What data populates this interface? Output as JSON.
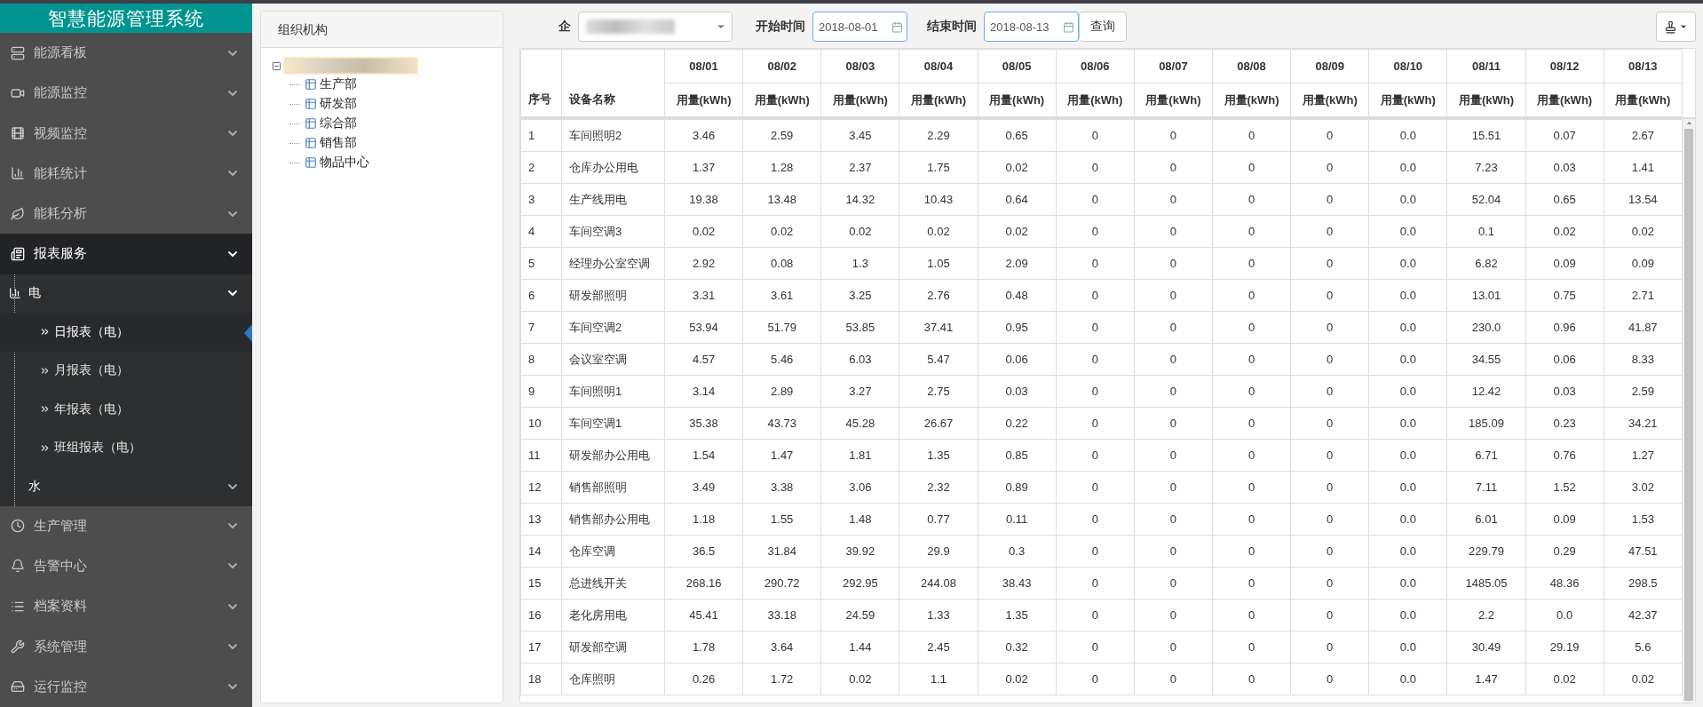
{
  "sidebar": {
    "title": "智慧能源管理系统",
    "items": [
      {
        "label": "能源看板",
        "expanded": false,
        "selected": false
      },
      {
        "label": "能源监控",
        "expanded": false,
        "selected": false
      },
      {
        "label": "视频监控",
        "expanded": false,
        "selected": false
      },
      {
        "label": "能耗统计",
        "expanded": false,
        "selected": false
      },
      {
        "label": "能耗分析",
        "expanded": false,
        "selected": false
      },
      {
        "label": "报表服务",
        "expanded": true,
        "selected": true,
        "children": [
          {
            "label": "电",
            "expanded": true,
            "children": [
              {
                "label": "日报表（电）",
                "selected": true
              },
              {
                "label": "月报表（电）",
                "selected": false
              },
              {
                "label": "年报表（电）",
                "selected": false
              },
              {
                "label": "班组报表（电）",
                "selected": false
              }
            ]
          },
          {
            "label": "水",
            "expanded": false
          }
        ]
      },
      {
        "label": "生产管理",
        "expanded": false,
        "selected": false
      },
      {
        "label": "告警中心",
        "expanded": false,
        "selected": false
      },
      {
        "label": "档案资料",
        "expanded": false,
        "selected": false
      },
      {
        "label": "系统管理",
        "expanded": false,
        "selected": false
      },
      {
        "label": "运行监控",
        "expanded": false,
        "selected": false
      }
    ]
  },
  "org_panel": {
    "title": "组织机构",
    "root": {
      "expanded": true,
      "children": [
        {
          "label": "生产部"
        },
        {
          "label": "研发部"
        },
        {
          "label": "综合部"
        },
        {
          "label": "销售部"
        },
        {
          "label": "物品中心"
        }
      ]
    }
  },
  "toolbar": {
    "enterprise_label": "企",
    "start_label": "开始时间",
    "start_value": "2018-08-01",
    "end_label": "结束时间",
    "end_value": "2018-08-13",
    "query_button": "查询"
  },
  "table": {
    "columns": [
      "序号",
      "设备名称"
    ],
    "dates": [
      {
        "date": "08/01",
        "unit": "用量(kWh)"
      },
      {
        "date": "08/02",
        "unit": "用量(kWh)"
      },
      {
        "date": "08/03",
        "unit": "用量(kWh)"
      },
      {
        "date": "08/04",
        "unit": "用量(kWh)"
      },
      {
        "date": "08/05",
        "unit": "用量(kWh)"
      },
      {
        "date": "08/06",
        "unit": "用量(kWh)"
      },
      {
        "date": "08/07",
        "unit": "用量(kWh)"
      },
      {
        "date": "08/08",
        "unit": "用量(kWh)"
      },
      {
        "date": "08/09",
        "unit": "用量(kWh)"
      },
      {
        "date": "08/10",
        "unit": "用量(kWh)"
      },
      {
        "date": "08/11",
        "unit": "用量(kWh)"
      },
      {
        "date": "08/12",
        "unit": "用量(kWh)"
      },
      {
        "date": "08/13",
        "unit": "用量(kWh)"
      }
    ],
    "rows": [
      {
        "no": "1",
        "name": "车间照明2",
        "values": [
          "3.46",
          "2.59",
          "3.45",
          "2.29",
          "0.65",
          "0",
          "0",
          "0",
          "0",
          "0.0",
          "15.51",
          "0.07",
          "2.67"
        ]
      },
      {
        "no": "2",
        "name": "仓库办公用电",
        "values": [
          "1.37",
          "1.28",
          "2.37",
          "1.75",
          "0.02",
          "0",
          "0",
          "0",
          "0",
          "0.0",
          "7.23",
          "0.03",
          "1.41"
        ]
      },
      {
        "no": "3",
        "name": "生产线用电",
        "values": [
          "19.38",
          "13.48",
          "14.32",
          "10.43",
          "0.64",
          "0",
          "0",
          "0",
          "0",
          "0.0",
          "52.04",
          "0.65",
          "13.54"
        ]
      },
      {
        "no": "4",
        "name": "车间空调3",
        "values": [
          "0.02",
          "0.02",
          "0.02",
          "0.02",
          "0.02",
          "0",
          "0",
          "0",
          "0",
          "0.0",
          "0.1",
          "0.02",
          "0.02"
        ]
      },
      {
        "no": "5",
        "name": "经理办公室空调",
        "values": [
          "2.92",
          "0.08",
          "1.3",
          "1.05",
          "2.09",
          "0",
          "0",
          "0",
          "0",
          "0.0",
          "6.82",
          "0.09",
          "0.09"
        ]
      },
      {
        "no": "6",
        "name": "研发部照明",
        "values": [
          "3.31",
          "3.61",
          "3.25",
          "2.76",
          "0.48",
          "0",
          "0",
          "0",
          "0",
          "0.0",
          "13.01",
          "0.75",
          "2.71"
        ]
      },
      {
        "no": "7",
        "name": "车间空调2",
        "values": [
          "53.94",
          "51.79",
          "53.85",
          "37.41",
          "0.95",
          "0",
          "0",
          "0",
          "0",
          "0.0",
          "230.0",
          "0.96",
          "41.87"
        ]
      },
      {
        "no": "8",
        "name": "会议室空调",
        "values": [
          "4.57",
          "5.46",
          "6.03",
          "5.47",
          "0.06",
          "0",
          "0",
          "0",
          "0",
          "0.0",
          "34.55",
          "0.06",
          "8.33"
        ]
      },
      {
        "no": "9",
        "name": "车间照明1",
        "values": [
          "3.14",
          "2.89",
          "3.27",
          "2.75",
          "0.03",
          "0",
          "0",
          "0",
          "0",
          "0.0",
          "12.42",
          "0.03",
          "2.59"
        ]
      },
      {
        "no": "10",
        "name": "车间空调1",
        "values": [
          "35.38",
          "43.73",
          "45.28",
          "26.67",
          "0.22",
          "0",
          "0",
          "0",
          "0",
          "0.0",
          "185.09",
          "0.23",
          "34.21"
        ]
      },
      {
        "no": "11",
        "name": "研发部办公用电",
        "values": [
          "1.54",
          "1.47",
          "1.81",
          "1.35",
          "0.85",
          "0",
          "0",
          "0",
          "0",
          "0.0",
          "6.71",
          "0.76",
          "1.27"
        ]
      },
      {
        "no": "12",
        "name": "销售部照明",
        "values": [
          "3.49",
          "3.38",
          "3.06",
          "2.32",
          "0.89",
          "0",
          "0",
          "0",
          "0",
          "0.0",
          "7.11",
          "1.52",
          "3.02"
        ]
      },
      {
        "no": "13",
        "name": "销售部办公用电",
        "values": [
          "1.18",
          "1.55",
          "1.48",
          "0.77",
          "0.11",
          "0",
          "0",
          "0",
          "0",
          "0.0",
          "6.01",
          "0.09",
          "1.53"
        ]
      },
      {
        "no": "14",
        "name": "仓库空调",
        "values": [
          "36.5",
          "31.84",
          "39.92",
          "29.9",
          "0.3",
          "0",
          "0",
          "0",
          "0",
          "0.0",
          "229.79",
          "0.29",
          "47.51"
        ]
      },
      {
        "no": "15",
        "name": "总进线开关",
        "values": [
          "268.16",
          "290.72",
          "292.95",
          "244.08",
          "38.43",
          "0",
          "0",
          "0",
          "0",
          "0.0",
          "1485.05",
          "48.36",
          "298.5"
        ]
      },
      {
        "no": "16",
        "name": "老化房用电",
        "values": [
          "45.41",
          "33.18",
          "24.59",
          "1.33",
          "1.35",
          "0",
          "0",
          "0",
          "0",
          "0.0",
          "2.2",
          "0.0",
          "42.37"
        ]
      },
      {
        "no": "17",
        "name": "研发部空调",
        "values": [
          "1.78",
          "3.64",
          "1.44",
          "2.45",
          "0.32",
          "0",
          "0",
          "0",
          "0",
          "0.0",
          "30.49",
          "29.19",
          "5.6"
        ]
      },
      {
        "no": "18",
        "name": "仓库照明",
        "values": [
          "0.26",
          "1.72",
          "0.02",
          "1.1",
          "0.02",
          "0",
          "0",
          "0",
          "0",
          "0.0",
          "1.47",
          "0.02",
          "0.02"
        ]
      }
    ]
  }
}
